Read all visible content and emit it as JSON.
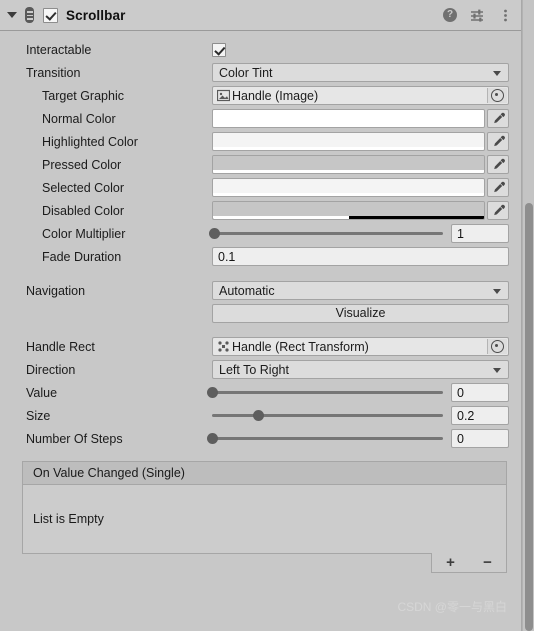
{
  "header": {
    "title": "Scrollbar",
    "enabled_checkbox": true,
    "foldout_expanded": true,
    "icons": {
      "script": "script-icon",
      "help": "?",
      "preset": "preset-icon",
      "menu": "kebab-menu-icon"
    }
  },
  "properties": {
    "interactable": {
      "label": "Interactable",
      "value": true
    },
    "transition": {
      "label": "Transition",
      "value": "Color Tint"
    },
    "target_graphic": {
      "label": "Target Graphic",
      "value": "Handle (Image)",
      "icon": "image-icon"
    },
    "normal_color": {
      "label": "Normal Color",
      "color": "#ffffff",
      "alpha": 1
    },
    "highlighted_color": {
      "label": "Highlighted Color",
      "color": "#f4f4f4",
      "alpha": 1
    },
    "pressed_color": {
      "label": "Pressed Color",
      "color": "#c8c8c8",
      "alpha": 1
    },
    "selected_color": {
      "label": "Selected Color",
      "color": "#f4f4f4",
      "alpha": 1
    },
    "disabled_color": {
      "label": "Disabled Color",
      "color": "#c8c8c8",
      "alpha": 0.5
    },
    "color_multiplier": {
      "label": "Color Multiplier",
      "value": "1",
      "slider_pct": 1
    },
    "fade_duration": {
      "label": "Fade Duration",
      "value": "0.1"
    },
    "navigation": {
      "label": "Navigation",
      "value": "Automatic"
    },
    "visualize": {
      "label": "Visualize"
    },
    "handle_rect": {
      "label": "Handle Rect",
      "value": "Handle (Rect Transform)",
      "icon": "rect-transform-icon"
    },
    "direction": {
      "label": "Direction",
      "value": "Left To Right"
    },
    "scroll_value": {
      "label": "Value",
      "value": "0",
      "slider_pct": 0
    },
    "size": {
      "label": "Size",
      "value": "0.2",
      "slider_pct": 20
    },
    "number_of_steps": {
      "label": "Number Of Steps",
      "value": "0",
      "slider_pct": 0
    }
  },
  "events": {
    "title": "On Value Changed (Single)",
    "empty_text": "List is Empty",
    "add_label": "+",
    "remove_label": "−"
  },
  "watermark": {
    "text": "CSDN @零一与黑白"
  }
}
